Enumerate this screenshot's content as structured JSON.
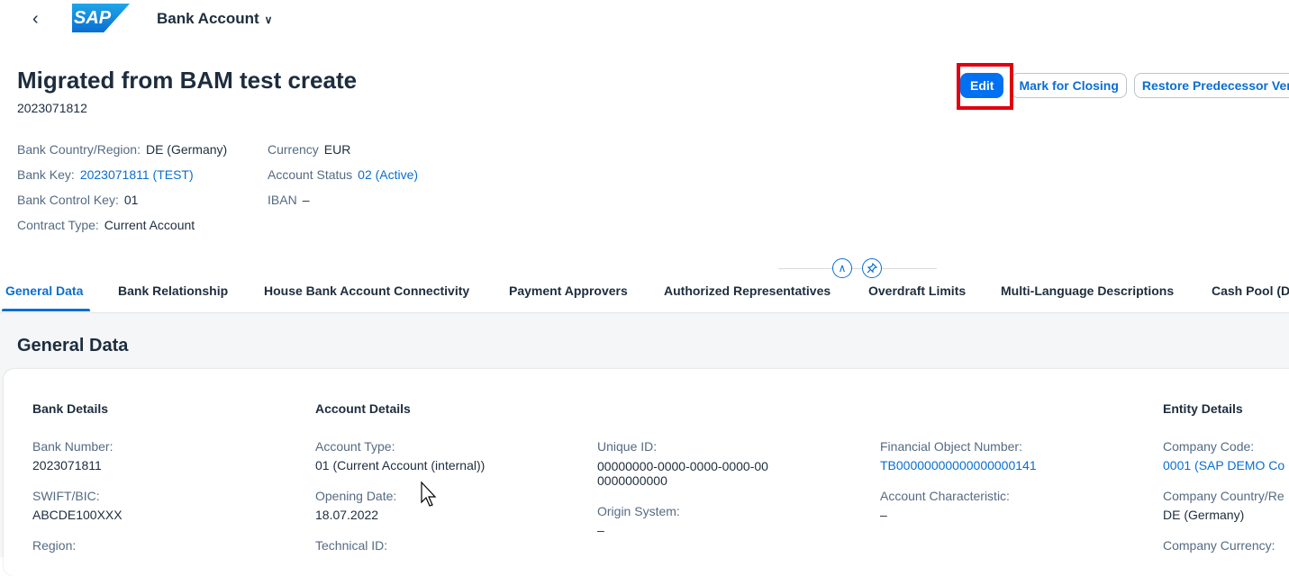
{
  "shell": {
    "back_icon": "chevron-left-icon",
    "logo_text": "SAP",
    "app_title": "Bank Account"
  },
  "header": {
    "title": "Migrated from BAM test create",
    "subtitle": "2023071812",
    "actions": {
      "edit": "Edit",
      "mark_for_closing": "Mark for Closing",
      "restore": "Restore Predecessor Ver"
    },
    "attributes": {
      "bank_country_label": "Bank Country/Region:",
      "bank_country_value": "DE (Germany)",
      "bank_key_label": "Bank Key:",
      "bank_key_value": "2023071811 (TEST)",
      "bank_control_key_label": "Bank Control Key:",
      "bank_control_key_value": "01",
      "contract_type_label": "Contract Type:",
      "contract_type_value": "Current Account",
      "currency_label": "Currency",
      "currency_value": "EUR",
      "account_status_label": "Account Status",
      "account_status_value": "02 (Active)",
      "iban_label": "IBAN",
      "iban_value": "–"
    }
  },
  "tabs": [
    "General Data",
    "Bank Relationship",
    "House Bank Account Connectivity",
    "Payment Approvers",
    "Authorized Representatives",
    "Overdraft Limits",
    "Multi-Language Descriptions",
    "Cash Pool (D"
  ],
  "section": {
    "title": "General Data",
    "groups": {
      "bank_details": "Bank Details",
      "account_details": "Account Details",
      "entity_details": "Entity Details"
    },
    "fields": {
      "bank_number_label": "Bank Number:",
      "bank_number_value": "2023071811",
      "swift_label": "SWIFT/BIC:",
      "swift_value": "ABCDE100XXX",
      "region_label": "Region:",
      "account_type_label": "Account Type:",
      "account_type_value": "01 (Current Account (internal))",
      "opening_date_label": "Opening Date:",
      "opening_date_value": "18.07.2022",
      "technical_id_label": "Technical ID:",
      "unique_id_label": "Unique ID:",
      "unique_id_value": "00000000-0000-0000-0000-000000000000",
      "origin_system_label": "Origin System:",
      "origin_system_value": "–",
      "fin_obj_label": "Financial Object Number:",
      "fin_obj_value": "TB00000000000000000141",
      "account_char_label": "Account Characteristic:",
      "account_char_value": "–",
      "company_code_label": "Company Code:",
      "company_code_value": "0001 (SAP DEMO Co",
      "company_country_label": "Company Country/Re",
      "company_country_value": "DE (Germany)",
      "company_currency_label": "Company Currency:"
    }
  },
  "colors": {
    "brand": "#0a6ed1",
    "emphasized_button": "#0070f2",
    "highlight_box": "#e0000e"
  }
}
